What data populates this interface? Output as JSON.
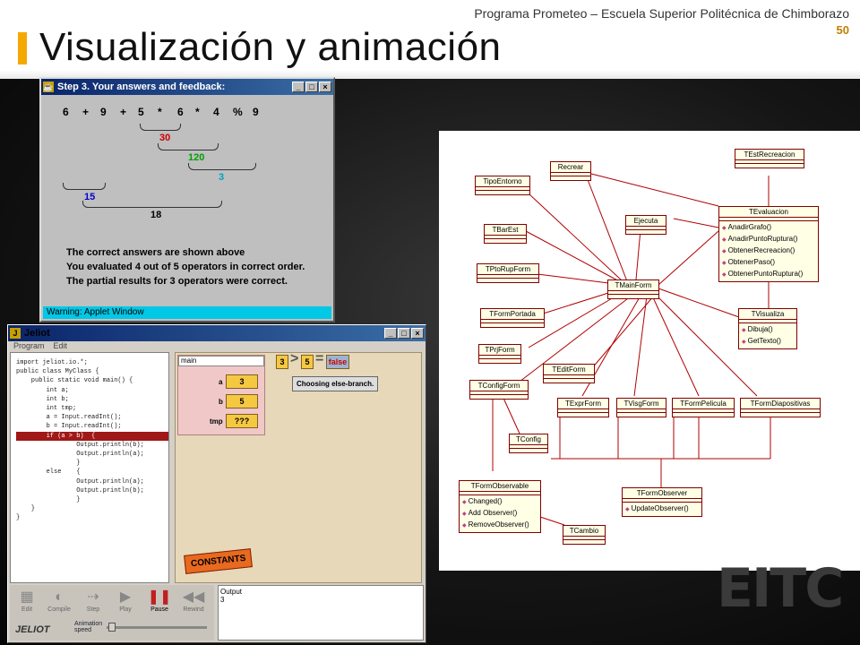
{
  "slide": {
    "title": "Visualización y animación",
    "organization": "Programa Prometeo – Escuela Superior Politécnica de Chimborazo",
    "page_number": "50",
    "accent_color": "#f5a800"
  },
  "applet": {
    "window_title": "Step 3. Your answers and feedback:",
    "expression": [
      "6",
      "+",
      "9",
      "+",
      "5",
      "*",
      "6",
      "*",
      "4",
      "%",
      "9"
    ],
    "partials": [
      "30",
      "120",
      "3",
      "15",
      "18"
    ],
    "feedback": [
      "The correct answers are shown above",
      "You evaluated 4 out of 5 operators in correct order.",
      "The partial results for 3 operators were correct."
    ],
    "warning": "Warning: Applet Window"
  },
  "jeliot": {
    "window_title": "Jeliot",
    "menu": [
      "Program",
      "Edit"
    ],
    "code_lines": [
      "import jeliot.io.*;",
      "",
      "public class MyClass {",
      "    public static void main() {",
      "        int a;",
      "        int b;",
      "        int tmp;",
      "",
      "        a = Input.readInt();",
      "        b = Input.readInt();",
      "",
      "        if (a > b)  {",
      "                Output.println(b);",
      "                Output.println(a);",
      "                }",
      "        else    {",
      "                Output.println(a);",
      "                Output.println(b);",
      "                }",
      "    }",
      "}"
    ],
    "frame_name": "main",
    "vars": [
      {
        "name": "a",
        "value": "3"
      },
      {
        "name": "b",
        "value": "5"
      },
      {
        "name": "tmp",
        "value": "???"
      }
    ],
    "comparison": {
      "left": "3",
      "op": ">",
      "right": "5",
      "result": "false"
    },
    "message": "Choosing else-branch.",
    "constants_label": "CONSTANTS",
    "buttons": [
      "Edit",
      "Compile",
      "Step",
      "Play",
      "Pause",
      "Rewind"
    ],
    "brand": "JELIOT",
    "speed_label": "Animation speed",
    "output_label": "Output",
    "output_value": "3"
  },
  "uml": {
    "classes": {
      "TEstRecreacion": "TEstRecreacion",
      "Recrear": "Recrear",
      "TipoEntorno": "TipoEntorno",
      "TEvaluacion": "TEvaluacion",
      "Ejecuta": "Ejecuta",
      "TBarEst": "TBarEst",
      "TPtoRupForm": "TPtoRupForm",
      "TMainForm": "TMainForm",
      "TFormPortada": "TFormPortada",
      "TVisualiza": "TVisualiza",
      "TPrjForm": "TPrjForm",
      "TEditForm": "TEditForm",
      "TConfigForm": "TConfigForm",
      "TExprForm": "TExprForm",
      "TVisgForm": "TVisgForm",
      "TFormPelicula": "TFormPelicula",
      "TFormDiapositivas": "TFormDiapositivas",
      "TConfig": "TConfig",
      "TFormObservable": "TFormObservable",
      "TFormObserver": "TFormObserver",
      "TCambio": "TCambio"
    },
    "ops": {
      "TEvaluacion": [
        "AnadirGrafo()",
        "AnadirPuntoRuptura()",
        "ObtenerRecreacion()",
        "ObtenerPaso()",
        "ObtenerPuntoRuptura()"
      ],
      "TVisualiza": [
        "Dibuja()",
        "GetTexto()"
      ],
      "TFormObservable": [
        "Changed()",
        "Add Observer()",
        "RemoveObserver()"
      ],
      "TFormObserver": [
        "UpdateObserver()"
      ]
    }
  }
}
